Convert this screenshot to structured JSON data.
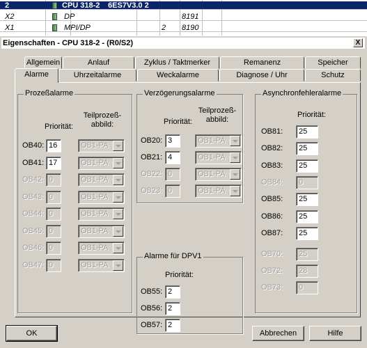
{
  "background_table": {
    "rows": [
      {
        "slot": "2",
        "name": "CPU 318-2",
        "order": "6ES7V3.0 2",
        "selected": true
      },
      {
        "slot": "X2",
        "name": "DP",
        "mpi": "",
        "addr": "8191"
      },
      {
        "slot": "X1",
        "name": "MPI/DP",
        "mpi": "2",
        "addr": "8190"
      }
    ]
  },
  "dialog": {
    "title": "Eigenschaften - CPU 318-2 - (R0/S2)",
    "close_label": "X",
    "tabs_back": [
      "Allgemein",
      "Anlauf",
      "Zyklus / Taktmerker",
      "Remanenz",
      "Speicher"
    ],
    "tabs_front": [
      "Alarme",
      "Uhrzeitalarme",
      "Weckalarme",
      "Diagnose / Uhr",
      "Schutz"
    ],
    "ok_label": "OK",
    "cancel_label": "Abbrechen",
    "help_label": "Hilfe"
  },
  "prozessalarme": {
    "title": "Prozeßalarme",
    "prio_header": "Priorität:",
    "teil_header_1": "Teilprozeß-",
    "teil_header_2": "abbild:",
    "rows": [
      {
        "label": "OB40:",
        "prio": "16",
        "tpa": "OB1-PA",
        "enabled": true
      },
      {
        "label": "OB41:",
        "prio": "17",
        "tpa": "OB1-PA",
        "enabled": true
      },
      {
        "label": "OB42:",
        "prio": "0",
        "tpa": "OB1-PA",
        "enabled": false
      },
      {
        "label": "OB43:",
        "prio": "0",
        "tpa": "OB1-PA",
        "enabled": false
      },
      {
        "label": "OB44:",
        "prio": "0",
        "tpa": "OB1-PA",
        "enabled": false
      },
      {
        "label": "OB45:",
        "prio": "0",
        "tpa": "OB1-PA",
        "enabled": false
      },
      {
        "label": "OB46:",
        "prio": "0",
        "tpa": "OB1-PA",
        "enabled": false
      },
      {
        "label": "OB47:",
        "prio": "0",
        "tpa": "OB1-PA",
        "enabled": false
      }
    ]
  },
  "verzoegerung": {
    "title": "Verzögerungsalarme",
    "prio_header": "Priorität:",
    "teil_header_1": "Teilprozeß-",
    "teil_header_2": "abbild:",
    "rows": [
      {
        "label": "OB20:",
        "prio": "3",
        "tpa": "OB1-PA",
        "enabled": true
      },
      {
        "label": "OB21:",
        "prio": "4",
        "tpa": "OB1-PA",
        "enabled": true
      },
      {
        "label": "OB22:",
        "prio": "0",
        "tpa": "OB1-PA",
        "enabled": false
      },
      {
        "label": "OB23:",
        "prio": "0",
        "tpa": "OB1-PA",
        "enabled": false
      }
    ]
  },
  "dpv1": {
    "title": "Alarme für DPV1",
    "prio_header": "Priorität:",
    "rows": [
      {
        "label": "OB55:",
        "prio": "2"
      },
      {
        "label": "OB56:",
        "prio": "2"
      },
      {
        "label": "OB57:",
        "prio": "2"
      }
    ]
  },
  "asynchron": {
    "title": "Asynchronfehleralarme",
    "prio_header": "Priorität:",
    "rows": [
      {
        "label": "OB81:",
        "prio": "25",
        "enabled": true
      },
      {
        "label": "OB82:",
        "prio": "25",
        "enabled": true
      },
      {
        "label": "OB83:",
        "prio": "25",
        "enabled": true
      },
      {
        "label": "OB84:",
        "prio": "0",
        "enabled": false
      },
      {
        "label": "OB85:",
        "prio": "25",
        "enabled": true
      },
      {
        "label": "OB86:",
        "prio": "25",
        "enabled": true
      },
      {
        "label": "OB87:",
        "prio": "25",
        "enabled": true
      },
      {
        "label": "OB70:",
        "prio": "25",
        "enabled": false
      },
      {
        "label": "OB72:",
        "prio": "28",
        "enabled": false
      },
      {
        "label": "OB73:",
        "prio": "0",
        "enabled": false
      }
    ]
  }
}
